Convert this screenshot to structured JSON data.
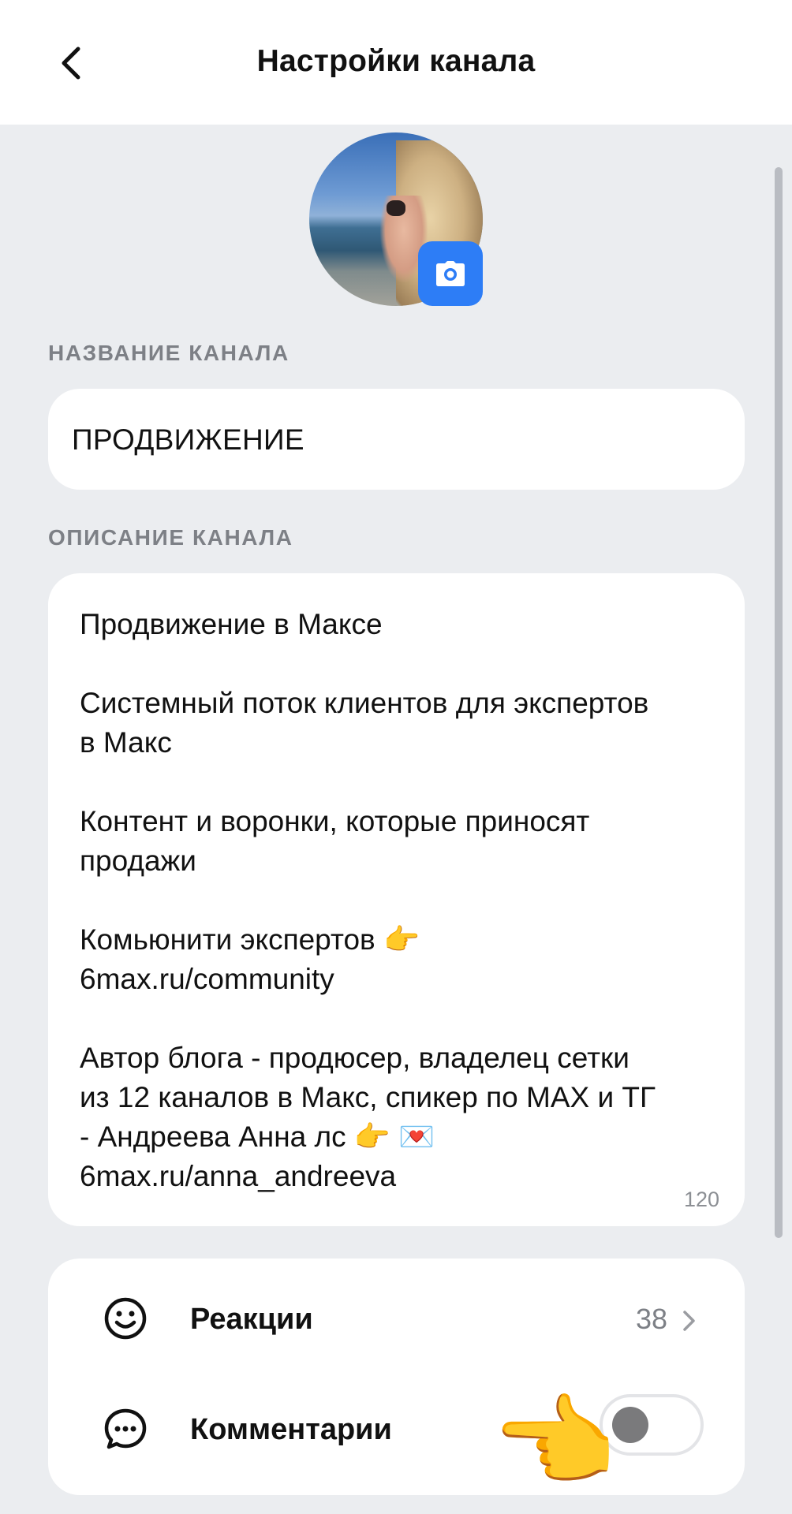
{
  "header": {
    "title": "Настройки канала"
  },
  "name_section": {
    "label": "НАЗВАНИЕ КАНАЛА",
    "value": "ПРОДВИЖЕНИЕ"
  },
  "description_section": {
    "label": "ОПИСАНИЕ КАНАЛА",
    "lines": [
      "Продвижение в Максе",
      "",
      "Системный поток клиентов для экспертов",
      "в Макс",
      "",
      "Контент и воронки, которые приносят",
      "продажи",
      "",
      "Комьюнити экспертов 👉",
      "6max.ru/community",
      "",
      "Автор блога - продюсер, владелец сетки",
      "из 12 каналов в Макс, спикер по MAX и ТГ",
      "- Андреева Анна лс 👉 💌",
      "6max.ru/anna_andreeva"
    ],
    "char_count": "120"
  },
  "settings": {
    "reactions": {
      "label": "Реакции",
      "value": "38",
      "icon": "smiley-icon"
    },
    "comments": {
      "label": "Комментарии",
      "enabled": false,
      "icon": "comment-bubble-icon"
    }
  },
  "overlay": {
    "hand_emoji": "👉"
  },
  "colors": {
    "accent": "#2d7df6",
    "background": "#ebedf0",
    "card": "#ffffff",
    "muted_text": "#7d8086"
  }
}
